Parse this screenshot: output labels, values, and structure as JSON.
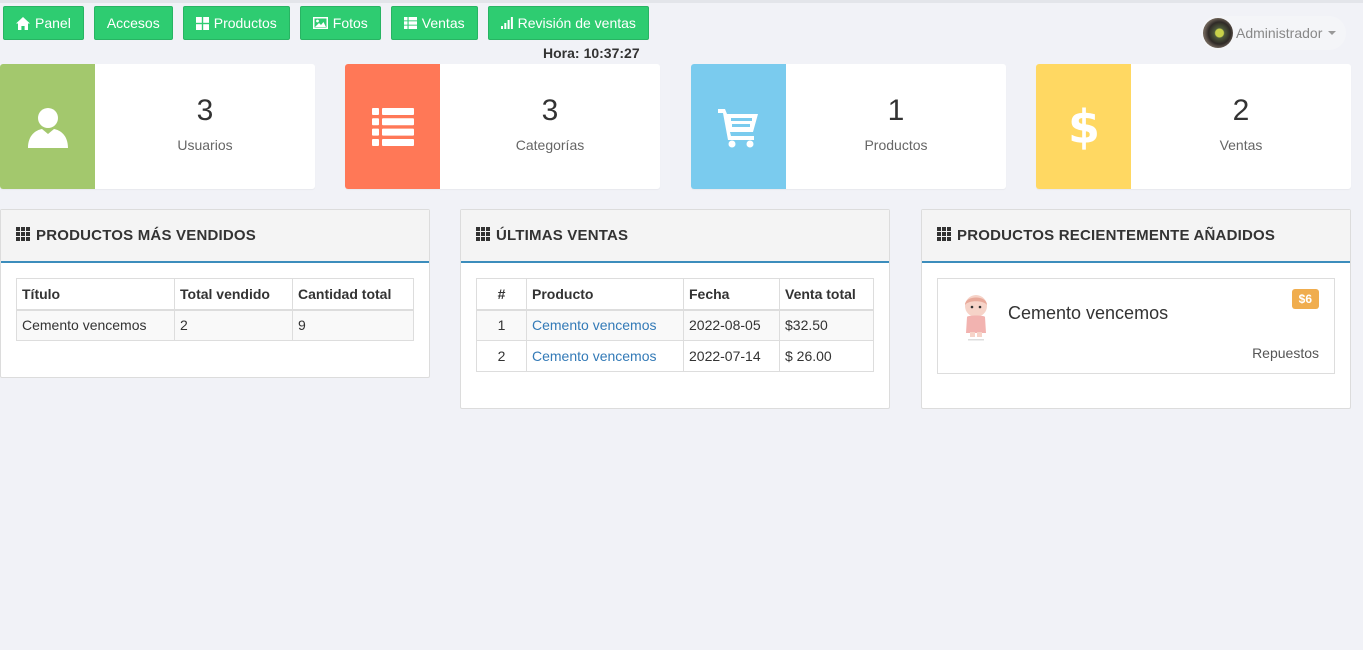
{
  "nav": [
    {
      "label": "Panel",
      "icon": "home-icon"
    },
    {
      "label": "Accesos",
      "icon": ""
    },
    {
      "label": "Productos",
      "icon": "th-large-icon"
    },
    {
      "label": "Fotos",
      "icon": "picture-icon"
    },
    {
      "label": "Ventas",
      "icon": "th-list-icon"
    },
    {
      "label": "Revisión de ventas",
      "icon": "signal-icon"
    }
  ],
  "hora": {
    "label": "Hora:",
    "value": "10:37:27"
  },
  "user": {
    "name": "Administrador"
  },
  "stats": [
    {
      "value": "3",
      "label": "Usuarios",
      "color": "#a3c86d",
      "icon": "user-icon"
    },
    {
      "value": "3",
      "label": "Categorías",
      "color": "#ff7857",
      "icon": "list-icon"
    },
    {
      "value": "1",
      "label": "Productos",
      "color": "#7acbee",
      "icon": "shopping-cart-icon"
    },
    {
      "value": "2",
      "label": "Ventas",
      "color": "#ffd862",
      "icon": "dollar-icon"
    }
  ],
  "panels": {
    "top_sellers": {
      "title": "PRODUCTOS MÁS VENDIDOS",
      "headers": [
        "Título",
        "Total vendido",
        "Cantidad total"
      ],
      "rows": [
        [
          "Cemento vencemos",
          "2",
          "9"
        ]
      ]
    },
    "latest_sales": {
      "title": "ÚLTIMAS VENTAS",
      "headers": [
        "#",
        "Producto",
        "Fecha",
        "Venta total"
      ],
      "rows": [
        [
          "1",
          "Cemento vencemos",
          "2022-08-05",
          "$32.50"
        ],
        [
          "2",
          "Cemento vencemos",
          "2022-07-14",
          "$ 26.00"
        ]
      ]
    },
    "recent": {
      "title": "PRODUCTOS RECIENTEMENTE AÑADIDOS",
      "item": {
        "name": "Cemento vencemos",
        "price": "$6",
        "category": "Repuestos"
      }
    }
  },
  "colors": {
    "nav_button": "#2ecc71",
    "panel_accent": "#3c8dbc",
    "link": "#337ab7",
    "badge": "#f0ad4e"
  }
}
